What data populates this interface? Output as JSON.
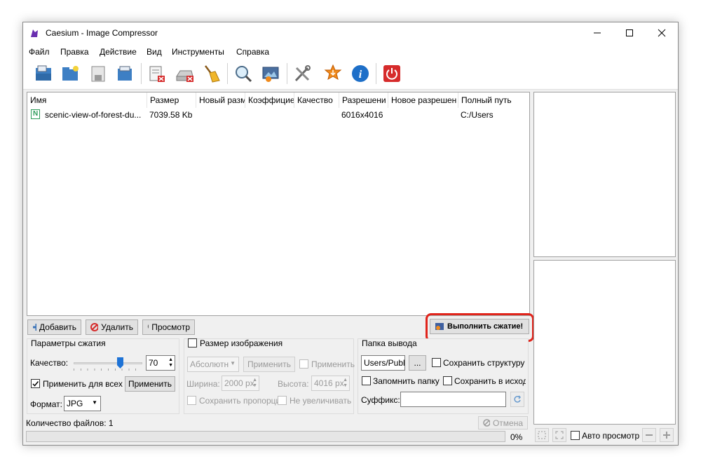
{
  "window": {
    "title": "Caesium - Image Compressor"
  },
  "menu": [
    "Файл",
    "Правка",
    "Действие",
    "Вид",
    "Инструменты",
    "Справка"
  ],
  "toolbar": {
    "icons": [
      "open-file-icon",
      "open-folder-icon",
      "save-icon",
      "save-all-icon",
      "remove-item-icon",
      "clear-list-icon",
      "clean-broom-icon",
      "zoom-icon",
      "preview-image-icon",
      "settings-tools-icon",
      "update-star-icon",
      "info-icon",
      "exit-power-icon"
    ]
  },
  "filelist": {
    "columns": [
      "Имя",
      "Размер",
      "Новый разм",
      "Коэффицие",
      "Качество",
      "Разрешени",
      "Новое разрешен",
      "Полный путь"
    ],
    "rows": [
      {
        "name": "scenic-view-of-forest-du...",
        "size": "7039.58 Kb",
        "new_size": "",
        "ratio": "",
        "quality": "",
        "resolution": "6016x4016",
        "new_resolution": "",
        "path": "C:/Users"
      }
    ]
  },
  "actions": {
    "add": "Добавить",
    "remove": "Удалить",
    "preview": "Просмотр",
    "compress": "Выполнить сжатие!"
  },
  "compression": {
    "title": "Параметры сжатия",
    "quality_label": "Качество:",
    "quality_value": "70",
    "quality_level": 70,
    "apply_all_label": "Применить для всех",
    "apply_all_checked": true,
    "apply_button": "Применить",
    "format_label": "Формат:",
    "format_value": "JPG"
  },
  "resize": {
    "title": "Размер изображения",
    "mode": "Абсолютн",
    "apply_button": "Применить",
    "apply_check": "Применить",
    "width_label": "Ширина:",
    "width_value": "2000 px",
    "height_label": "Высота:",
    "height_value": "4016 px",
    "keep_ratio": "Сохранить пропорци",
    "no_enlarge": "Не увеличивать"
  },
  "output": {
    "title": "Папка вывода",
    "path_value": "Users/Public",
    "browse_button": "...",
    "keep_structure": "Сохранить структуру",
    "remember_folder": "Запомнить папку",
    "save_in_source": "Сохранить в исходн",
    "suffix_label": "Суффикс:",
    "suffix_value": ""
  },
  "status": {
    "file_count": "Количество файлов: 1",
    "cancel_button": "Отмена",
    "progress_text": "0%",
    "progress": 0
  },
  "preview_panel": {
    "auto_preview": "Авто просмотр"
  },
  "colors": {
    "highlight": "#e0241b",
    "link_blue": "#1a5fb4"
  }
}
